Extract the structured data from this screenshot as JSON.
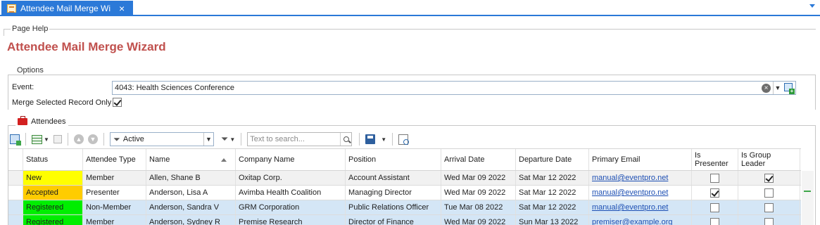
{
  "tab": {
    "title": "Attendee Mail Merge Wi...",
    "close": "×"
  },
  "page_help": {
    "label": "Page Help",
    "title": "Attendee Mail Merge Wizard"
  },
  "options": {
    "label": "Options",
    "event_label": "Event:",
    "event_value": "4043: Health Sciences Conference",
    "merge_label": "Merge Selected Record Only",
    "merge_checked": true
  },
  "attendees": {
    "label": "Attendees",
    "filter_value": "Active",
    "search_placeholder": "Text to search...",
    "columns": [
      {
        "key": "status",
        "label": "Status"
      },
      {
        "key": "type",
        "label": "Attendee Type"
      },
      {
        "key": "name",
        "label": "Name"
      },
      {
        "key": "company",
        "label": "Company Name"
      },
      {
        "key": "position",
        "label": "Position"
      },
      {
        "key": "arrival",
        "label": "Arrival Date"
      },
      {
        "key": "departure",
        "label": "Departure Date"
      },
      {
        "key": "email",
        "label": "Primary Email"
      },
      {
        "key": "presenter",
        "label": "Is Presenter"
      },
      {
        "key": "leader",
        "label": "Is Group Leader"
      }
    ],
    "rows": [
      {
        "status": "New",
        "status_color": "#ffff00",
        "type": "Member",
        "name": "Allen, Shane B",
        "company": "Oxitap Corp.",
        "position": "Account Assistant",
        "arrival": "Wed Mar 09 2022",
        "departure": "Sat Mar 12 2022",
        "email": "manual@eventpro.net",
        "presenter": false,
        "leader": true,
        "row_style": "gray"
      },
      {
        "status": "Accepted",
        "status_color": "#ffcc00",
        "type": "Presenter",
        "name": "Anderson, Lisa A",
        "company": "Avimba Health Coalition",
        "position": "Managing Director",
        "arrival": "Wed Mar 09 2022",
        "departure": "Sat Mar 12 2022",
        "email": "manual@eventpro.net",
        "presenter": true,
        "leader": false,
        "row_style": "white"
      },
      {
        "status": "Registered",
        "status_color": "#00ee00",
        "type": "Non-Member",
        "name": "Anderson, Sandra V",
        "company": "GRM Corporation",
        "position": "Public Relations Officer",
        "arrival": "Tue Mar 08 2022",
        "departure": "Sat Mar 12 2022",
        "email": "manual@eventpro.net",
        "presenter": false,
        "leader": false,
        "row_style": "blue"
      },
      {
        "status": "Registered",
        "status_color": "#00ee00",
        "type": "Member",
        "name": "Anderson, Sydney R",
        "company": "Premise Research",
        "position": "Director of Finance",
        "arrival": "Wed Mar 09 2022",
        "departure": "Sun Mar 13 2022",
        "email": "premiser@example.org",
        "presenter": false,
        "leader": false,
        "row_style": "blue"
      }
    ]
  }
}
